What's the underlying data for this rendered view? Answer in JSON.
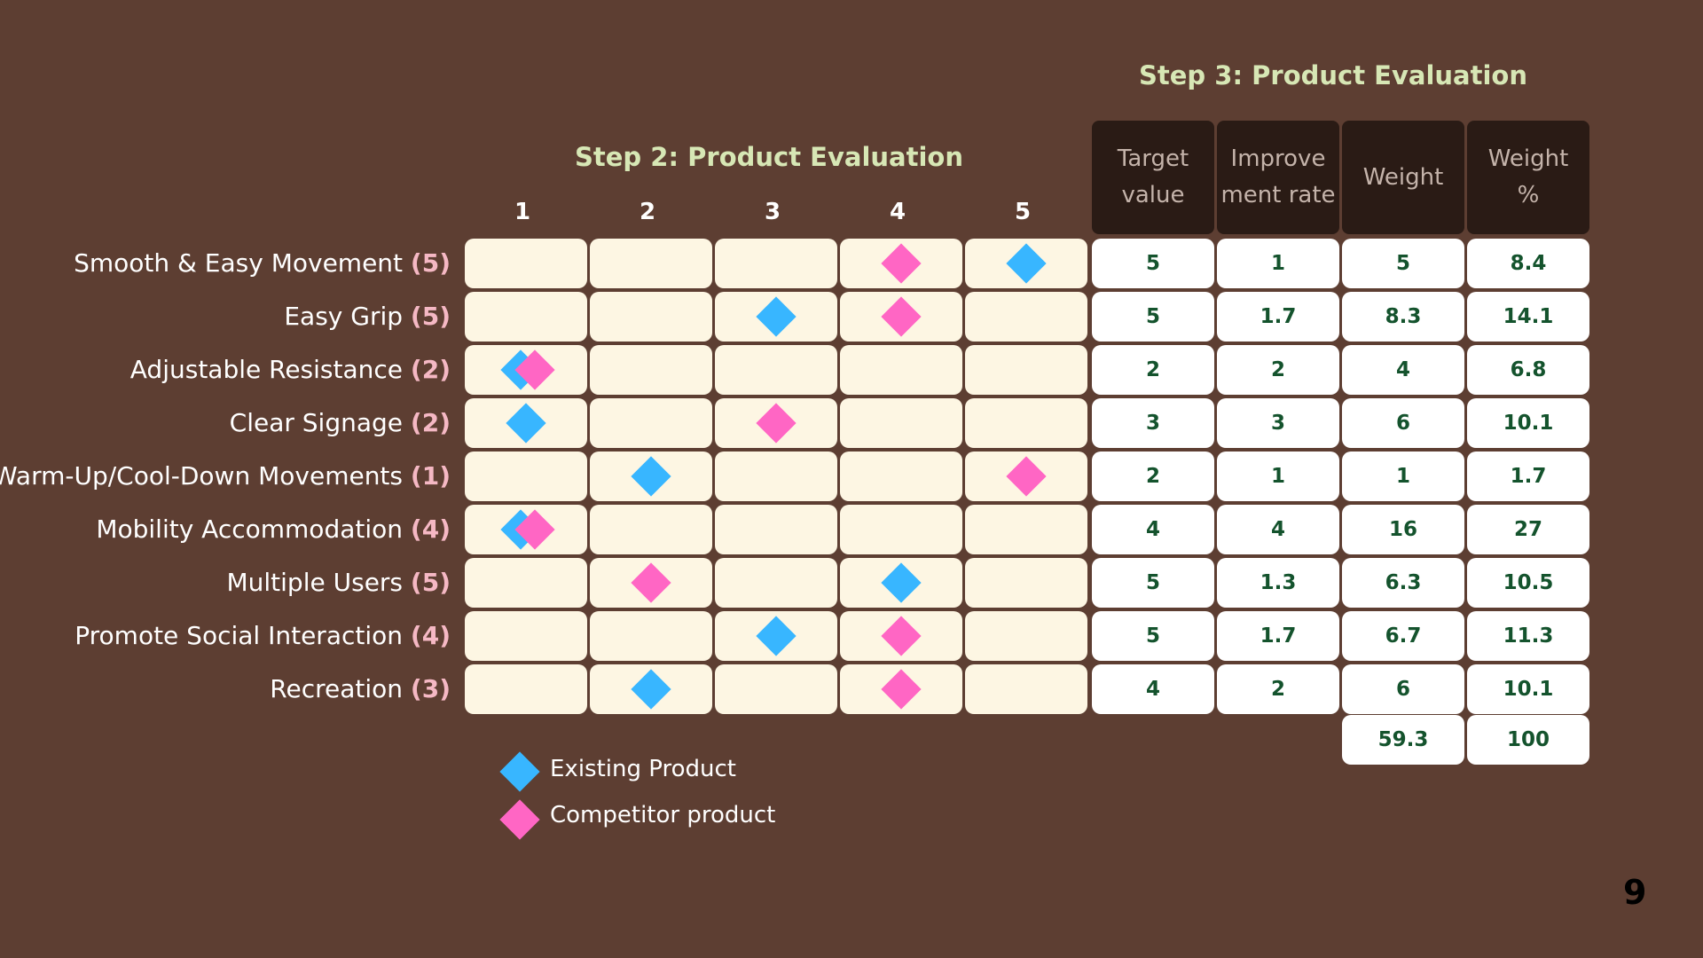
{
  "step2": {
    "title": "Step 2: Product Evaluation",
    "scale": [
      "1",
      "2",
      "3",
      "4",
      "5"
    ]
  },
  "step3": {
    "title": "Step 3: Product Evaluation",
    "headers": [
      {
        "line1": "Target",
        "line2": "value"
      },
      {
        "line1": "Improve",
        "line2": "ment rate"
      },
      {
        "line1": "Weight",
        "line2": ""
      },
      {
        "line1": "Weight",
        "line2": "%"
      }
    ],
    "totals": {
      "weight": "59.3",
      "weight_pct": "100"
    }
  },
  "rows": [
    {
      "label": "Smooth & Easy Movement",
      "priority": "(5)",
      "existing": 5,
      "competitor": 4,
      "target": "5",
      "improvement": "1",
      "weight": "5",
      "weight_pct": "8.4"
    },
    {
      "label": "Easy Grip",
      "priority": "(5)",
      "existing": 3,
      "competitor": 4,
      "target": "5",
      "improvement": "1.7",
      "weight": "8.3",
      "weight_pct": "14.1"
    },
    {
      "label": "Adjustable Resistance",
      "priority": "(2)",
      "existing": 1,
      "competitor": 1,
      "target": "2",
      "improvement": "2",
      "weight": "4",
      "weight_pct": "6.8"
    },
    {
      "label": "Clear Signage",
      "priority": "(2)",
      "existing": 1,
      "competitor": 3,
      "target": "3",
      "improvement": "3",
      "weight": "6",
      "weight_pct": "10.1"
    },
    {
      "label": "Warm-Up/Cool-Down Movements",
      "priority": "(1)",
      "existing": 2,
      "competitor": 5,
      "target": "2",
      "improvement": "1",
      "weight": "1",
      "weight_pct": "1.7"
    },
    {
      "label": "Mobility Accommodation",
      "priority": "(4)",
      "existing": 1,
      "competitor": 1,
      "target": "4",
      "improvement": "4",
      "weight": "16",
      "weight_pct": "27"
    },
    {
      "label": "Multiple Users",
      "priority": "(5)",
      "existing": 4,
      "competitor": 2,
      "target": "5",
      "improvement": "1.3",
      "weight": "6.3",
      "weight_pct": "10.5"
    },
    {
      "label": "Promote Social Interaction",
      "priority": "(4)",
      "existing": 3,
      "competitor": 4,
      "target": "5",
      "improvement": "1.7",
      "weight": "6.7",
      "weight_pct": "11.3"
    },
    {
      "label": "Recreation",
      "priority": "(3)",
      "existing": 2,
      "competitor": 4,
      "target": "4",
      "improvement": "2",
      "weight": "6",
      "weight_pct": "10.1"
    }
  ],
  "legend": {
    "existing": "Existing Product",
    "competitor": "Competitor product"
  },
  "colors": {
    "existing": "#38b6ff",
    "competitor": "#ff66c4"
  },
  "page_number": "9"
}
